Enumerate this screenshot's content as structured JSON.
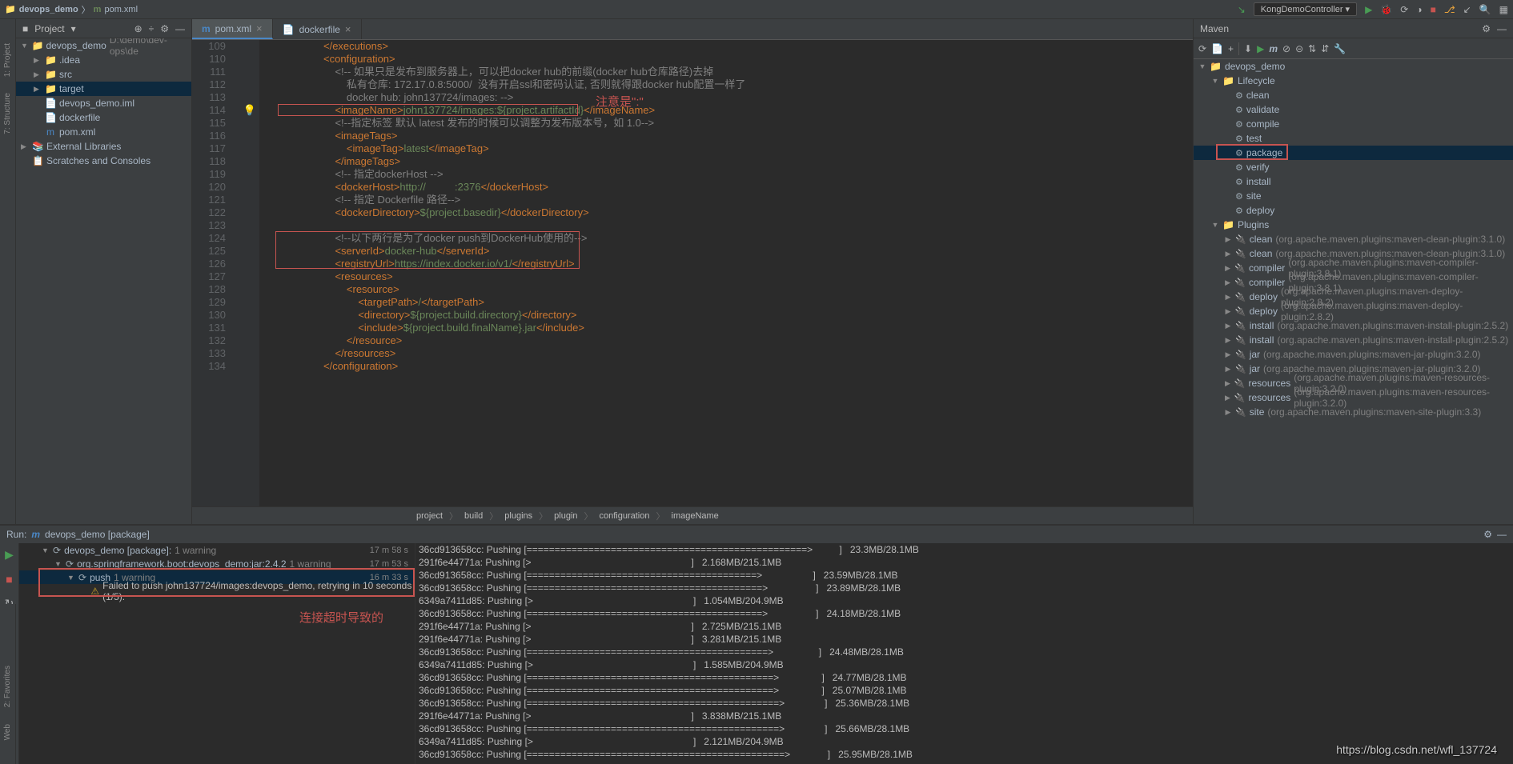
{
  "topbar": {
    "crumb_root": "devops_demo",
    "crumb_file": "pom.xml",
    "run_config": "KongDemoController"
  },
  "project_panel": {
    "title": "Project",
    "tree": [
      {
        "indent": 0,
        "arrow": "▼",
        "icon": "📁",
        "iconc": "#87939a",
        "label": "devops_demo",
        "tail": "D:\\demo\\dev-ops\\de",
        "sel": false
      },
      {
        "indent": 1,
        "arrow": "▶",
        "icon": "📁",
        "iconc": "#87939a",
        "label": ".idea",
        "sel": false
      },
      {
        "indent": 1,
        "arrow": "▶",
        "icon": "📁",
        "iconc": "#4a88c7",
        "label": "src",
        "sel": false
      },
      {
        "indent": 1,
        "arrow": "▶",
        "icon": "📁",
        "iconc": "#b09357",
        "label": "target",
        "sel": true
      },
      {
        "indent": 1,
        "arrow": "",
        "icon": "📄",
        "iconc": "#a9b7c6",
        "label": "devops_demo.iml",
        "sel": false
      },
      {
        "indent": 1,
        "arrow": "",
        "icon": "📄",
        "iconc": "#a9b7c6",
        "label": "dockerfile",
        "sel": false
      },
      {
        "indent": 1,
        "arrow": "",
        "icon": "m",
        "iconc": "#4a88c7",
        "label": "pom.xml",
        "sel": false
      },
      {
        "indent": 0,
        "arrow": "▶",
        "icon": "📚",
        "iconc": "#c9a227",
        "label": "External Libraries",
        "sel": false
      },
      {
        "indent": 0,
        "arrow": "",
        "icon": "📋",
        "iconc": "#87939a",
        "label": "Scratches and Consoles",
        "sel": false
      }
    ]
  },
  "tabs": [
    {
      "icon": "m",
      "iconc": "#4a88c7",
      "label": "pom.xml",
      "active": true
    },
    {
      "icon": "📄",
      "iconc": "#87939a",
      "label": "dockerfile",
      "active": false
    }
  ],
  "lines": [
    109,
    110,
    111,
    112,
    113,
    114,
    115,
    116,
    117,
    118,
    119,
    120,
    121,
    122,
    123,
    124,
    125,
    126,
    127,
    128,
    129,
    130,
    131,
    132,
    133,
    134
  ],
  "code_lines": [
    {
      "cls": "tag",
      "html": "</executions>"
    },
    {
      "cls": "tag",
      "html": "<configuration>"
    },
    {
      "cls": "cmt",
      "html": "    <!-- 如果只是发布到服务器上，可以把docker hub的前缀(docker hub仓库路径)去掉"
    },
    {
      "cls": "cmt",
      "html": "        私有仓库: 172.17.0.8:5000/  没有开启ssl和密码认证, 否则就得跟docker hub配置一样了"
    },
    {
      "cls": "cmt",
      "html": "        docker hub: john137724/images: -->"
    },
    {
      "cls": "mix",
      "html": "    <span class='tag'>&lt;imageName&gt;</span><span class='str'>john137724/images:${project.artifactId}</span><span class='tag'>&lt;/imageName&gt;</span>"
    },
    {
      "cls": "cmt",
      "html": "    <!--指定标签 默认 latest 发布的时候可以调整为发布版本号，如 1.0-->"
    },
    {
      "cls": "tag",
      "html": "    <imageTags>"
    },
    {
      "cls": "mix",
      "html": "        <span class='tag'>&lt;imageTag&gt;</span><span class='str'>latest</span><span class='tag'>&lt;/imageTag&gt;</span>"
    },
    {
      "cls": "tag",
      "html": "    </imageTags>"
    },
    {
      "cls": "cmt",
      "html": "    <!-- 指定dockerHost -->"
    },
    {
      "cls": "mix",
      "html": "    <span class='tag'>&lt;dockerHost&gt;</span><span class='str'>http://          :2376</span><span class='tag'>&lt;/dockerHost&gt;</span>"
    },
    {
      "cls": "cmt",
      "html": "    <!-- 指定 Dockerfile 路径-->"
    },
    {
      "cls": "mix",
      "html": "    <span class='tag'>&lt;dockerDirectory&gt;</span><span class='str'>${project.basedir}</span><span class='tag'>&lt;/dockerDirectory&gt;</span>"
    },
    {
      "cls": "",
      "html": ""
    },
    {
      "cls": "cmt",
      "html": "    <!--以下两行是为了docker push到DockerHub使用的-->"
    },
    {
      "cls": "mix",
      "html": "    <span class='tag'>&lt;serverId&gt;</span><span class='str'>docker-hub</span><span class='tag'>&lt;/serverId&gt;</span>"
    },
    {
      "cls": "mix",
      "html": "    <span class='tag'>&lt;registryUrl&gt;</span><span class='str'>https://index.docker.io/v1/</span><span class='tag'>&lt;/registryUrl&gt;</span>"
    },
    {
      "cls": "tag",
      "html": "    <resources>"
    },
    {
      "cls": "tag",
      "html": "        <resource>"
    },
    {
      "cls": "mix",
      "html": "            <span class='tag'>&lt;targetPath&gt;</span><span class='str'>/</span><span class='tag'>&lt;/targetPath&gt;</span>"
    },
    {
      "cls": "mix",
      "html": "            <span class='tag'>&lt;directory&gt;</span><span class='str'>${project.build.directory}</span><span class='tag'>&lt;/directory&gt;</span>"
    },
    {
      "cls": "mix",
      "html": "            <span class='tag'>&lt;include&gt;</span><span class='str'>${project.build.finalName}.jar</span><span class='tag'>&lt;/include&gt;</span>"
    },
    {
      "cls": "tag",
      "html": "        </resource>"
    },
    {
      "cls": "tag",
      "html": "    </resources>"
    },
    {
      "cls": "tag",
      "html": "</configuration>"
    }
  ],
  "bottom_crumbs": [
    "project",
    "build",
    "plugins",
    "plugin",
    "configuration",
    "imageName"
  ],
  "annotations": {
    "note1": "注意是\":\"",
    "note2": "连接超时导致的"
  },
  "maven": {
    "title": "Maven",
    "tree": [
      {
        "indent": 0,
        "arrow": "▼",
        "icon": "📁",
        "iconc": "#87939a",
        "label": "devops_demo"
      },
      {
        "indent": 1,
        "arrow": "▼",
        "icon": "📁",
        "iconc": "#87939a",
        "label": "Lifecycle"
      },
      {
        "indent": 2,
        "arrow": "",
        "icon": "⚙",
        "label": "clean",
        "cls": "gear"
      },
      {
        "indent": 2,
        "arrow": "",
        "icon": "⚙",
        "label": "validate",
        "cls": "gear"
      },
      {
        "indent": 2,
        "arrow": "",
        "icon": "⚙",
        "label": "compile",
        "cls": "gear"
      },
      {
        "indent": 2,
        "arrow": "",
        "icon": "⚙",
        "label": "test",
        "cls": "gear"
      },
      {
        "indent": 2,
        "arrow": "",
        "icon": "⚙",
        "label": "package",
        "cls": "gear",
        "sel": true,
        "box": true
      },
      {
        "indent": 2,
        "arrow": "",
        "icon": "⚙",
        "label": "verify",
        "cls": "gear"
      },
      {
        "indent": 2,
        "arrow": "",
        "icon": "⚙",
        "label": "install",
        "cls": "gear"
      },
      {
        "indent": 2,
        "arrow": "",
        "icon": "⚙",
        "label": "site",
        "cls": "gear"
      },
      {
        "indent": 2,
        "arrow": "",
        "icon": "⚙",
        "label": "deploy",
        "cls": "gear"
      },
      {
        "indent": 1,
        "arrow": "▼",
        "icon": "📁",
        "iconc": "#87939a",
        "label": "Plugins"
      },
      {
        "indent": 2,
        "arrow": "▶",
        "icon": "🔌",
        "label": "clean",
        "cls": "plug",
        "tail": "(org.apache.maven.plugins:maven-clean-plugin:3.1.0)"
      },
      {
        "indent": 2,
        "arrow": "▶",
        "icon": "🔌",
        "label": "clean",
        "cls": "plug",
        "tail": "(org.apache.maven.plugins:maven-clean-plugin:3.1.0)"
      },
      {
        "indent": 2,
        "arrow": "▶",
        "icon": "🔌",
        "label": "compiler",
        "cls": "plug",
        "tail": "(org.apache.maven.plugins:maven-compiler-plugin:3.8.1)"
      },
      {
        "indent": 2,
        "arrow": "▶",
        "icon": "🔌",
        "label": "compiler",
        "cls": "plug",
        "tail": "(org.apache.maven.plugins:maven-compiler-plugin:3.8.1)"
      },
      {
        "indent": 2,
        "arrow": "▶",
        "icon": "🔌",
        "label": "deploy",
        "cls": "plug",
        "tail": "(org.apache.maven.plugins:maven-deploy-plugin:2.8.2)"
      },
      {
        "indent": 2,
        "arrow": "▶",
        "icon": "🔌",
        "label": "deploy",
        "cls": "plug",
        "tail": "(org.apache.maven.plugins:maven-deploy-plugin:2.8.2)"
      },
      {
        "indent": 2,
        "arrow": "▶",
        "icon": "🔌",
        "label": "install",
        "cls": "plug",
        "tail": "(org.apache.maven.plugins:maven-install-plugin:2.5.2)"
      },
      {
        "indent": 2,
        "arrow": "▶",
        "icon": "🔌",
        "label": "install",
        "cls": "plug",
        "tail": "(org.apache.maven.plugins:maven-install-plugin:2.5.2)"
      },
      {
        "indent": 2,
        "arrow": "▶",
        "icon": "🔌",
        "label": "jar",
        "cls": "plug",
        "tail": "(org.apache.maven.plugins:maven-jar-plugin:3.2.0)"
      },
      {
        "indent": 2,
        "arrow": "▶",
        "icon": "🔌",
        "label": "jar",
        "cls": "plug",
        "tail": "(org.apache.maven.plugins:maven-jar-plugin:3.2.0)"
      },
      {
        "indent": 2,
        "arrow": "▶",
        "icon": "🔌",
        "label": "resources",
        "cls": "plug",
        "tail": "(org.apache.maven.plugins:maven-resources-plugin:3.2.0)"
      },
      {
        "indent": 2,
        "arrow": "▶",
        "icon": "🔌",
        "label": "resources",
        "cls": "plug",
        "tail": "(org.apache.maven.plugins:maven-resources-plugin:3.2.0)"
      },
      {
        "indent": 2,
        "arrow": "▶",
        "icon": "🔌",
        "label": "site",
        "cls": "plug",
        "tail": "(org.apache.maven.plugins:maven-site-plugin:3.3)"
      }
    ]
  },
  "run_panel": {
    "title": "Run:",
    "config_icon": "m",
    "config_label": "devops_demo [package]",
    "rows": [
      {
        "indent": 0,
        "arrow": "▼",
        "label": "devops_demo [package]:",
        "warn": "1 warning",
        "time": "17 m 58 s"
      },
      {
        "indent": 1,
        "arrow": "▼",
        "label": "org.springframework.boot:devops_demo:jar:2.4.2",
        "warn": "1 warning",
        "time": "17 m 53 s"
      },
      {
        "indent": 2,
        "arrow": "▼",
        "label": "push",
        "warn": "1 warning",
        "time": "16 m 33 s",
        "sel": true
      },
      {
        "indent": 3,
        "arrow": "",
        "label": "Failed to push john137724/images:devops_demo, retrying in 10 seconds (1/5).",
        "warnicon": true
      }
    ],
    "console": [
      {
        "hash": "36cd913658cc",
        "status": "Pushing [==================================================>",
        "size": "23.3MB/28.1MB"
      },
      {
        "hash": "291f6e44771a",
        "status": "Pushing [>",
        "size": "2.168MB/215.1MB"
      },
      {
        "hash": "36cd913658cc",
        "status": "Pushing [=========================================>",
        "size": "23.59MB/28.1MB"
      },
      {
        "hash": "36cd913658cc",
        "status": "Pushing [==========================================>",
        "size": "23.89MB/28.1MB"
      },
      {
        "hash": "6349a7411d85",
        "status": "Pushing [>",
        "size": "1.054MB/204.9MB"
      },
      {
        "hash": "36cd913658cc",
        "status": "Pushing [==========================================>",
        "size": "24.18MB/28.1MB"
      },
      {
        "hash": "291f6e44771a",
        "status": "Pushing [>",
        "size": "2.725MB/215.1MB"
      },
      {
        "hash": "291f6e44771a",
        "status": "Pushing [>",
        "size": "3.281MB/215.1MB"
      },
      {
        "hash": "36cd913658cc",
        "status": "Pushing [===========================================>",
        "size": "24.48MB/28.1MB"
      },
      {
        "hash": "6349a7411d85",
        "status": "Pushing [>",
        "size": "1.585MB/204.9MB"
      },
      {
        "hash": "36cd913658cc",
        "status": "Pushing [============================================>",
        "size": "24.77MB/28.1MB"
      },
      {
        "hash": "36cd913658cc",
        "status": "Pushing [============================================>",
        "size": "25.07MB/28.1MB"
      },
      {
        "hash": "36cd913658cc",
        "status": "Pushing [=============================================>",
        "size": "25.36MB/28.1MB"
      },
      {
        "hash": "291f6e44771a",
        "status": "Pushing [>",
        "size": "3.838MB/215.1MB"
      },
      {
        "hash": "36cd913658cc",
        "status": "Pushing [=============================================>",
        "size": "25.66MB/28.1MB"
      },
      {
        "hash": "6349a7411d85",
        "status": "Pushing [>",
        "size": "2.121MB/204.9MB"
      },
      {
        "hash": "36cd913658cc",
        "status": "Pushing [==============================================>",
        "size": "25.95MB/28.1MB"
      }
    ]
  },
  "watermark": "https://blog.csdn.net/wfl_137724"
}
